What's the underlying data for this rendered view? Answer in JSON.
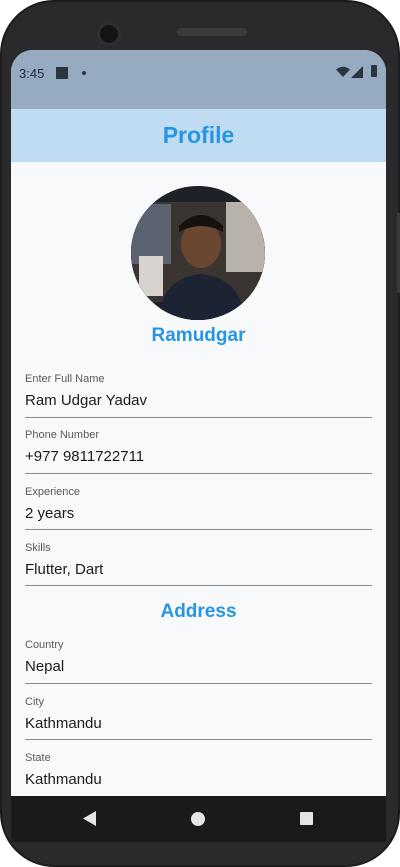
{
  "status_bar": {
    "time": "3:45"
  },
  "app_bar": {
    "title": "Profile"
  },
  "profile": {
    "username": "Ramudgar",
    "avatar_alt": "profile photo"
  },
  "fields": [
    {
      "label": "Enter Full  Name",
      "value": "Ram Udgar Yadav"
    },
    {
      "label": "Phone Number",
      "value": "+977 9811722711"
    },
    {
      "label": "Experience",
      "value": "2 years"
    },
    {
      "label": "Skills",
      "value": "Flutter, Dart"
    }
  ],
  "address": {
    "title": "Address",
    "fields": [
      {
        "label": "Country",
        "value": "Nepal"
      },
      {
        "label": "City",
        "value": "Kathmandu"
      },
      {
        "label": "State",
        "value": "Kathmandu"
      }
    ]
  },
  "colors": {
    "accent": "#2796e2",
    "app_bar_bg": "#bfdcf2",
    "status_bar_bg": "#96abbf"
  },
  "icons": {
    "status": [
      "notification-square-icon",
      "dot-icon",
      "wifi-icon",
      "signal-icon",
      "battery-icon"
    ],
    "navigation": [
      "back-icon",
      "home-icon",
      "recents-icon"
    ]
  }
}
